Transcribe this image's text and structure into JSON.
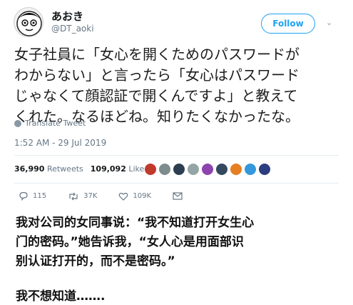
{
  "user": {
    "display_name": "あおき",
    "handle": "@DT_aoki",
    "avatar_icon": "cartoon-face-avatar"
  },
  "follow_label": "Follow",
  "tweet_lines": [
    "女子社員に「女心を開くためのパスワードが",
    "わからない」と言ったら「女心はパスワード",
    "じゃなくて顔認証で開くんですよ」と教えて",
    "くれた。なるほどね。知りたくなかったな。"
  ],
  "translate_label": "Translate Tweet",
  "timestamp": "1:52 AM - 29 Jul 2019",
  "stats": {
    "retweets_count": "36,990",
    "retweets_label": "Retweets",
    "likes_count": "109,092",
    "likes_label": "Likes"
  },
  "liker_avatars": [
    "#c0392b",
    "#7f8c8d",
    "#2c3e50",
    "#95a5a6",
    "#8e44ad",
    "#34495e",
    "#e67e22",
    "#3498db",
    "#2c3e80"
  ],
  "actions": {
    "reply_count": "115",
    "retweet_count": "37K",
    "like_count": "109K"
  },
  "caption_lines": [
    "我对公司的女同事说：“我不知道打开女生心",
    "门的密码。”她告诉我，“女人心是用面部识",
    "别认证打开的，而不是密码。”"
  ],
  "caption_end": "我不想知道……."
}
